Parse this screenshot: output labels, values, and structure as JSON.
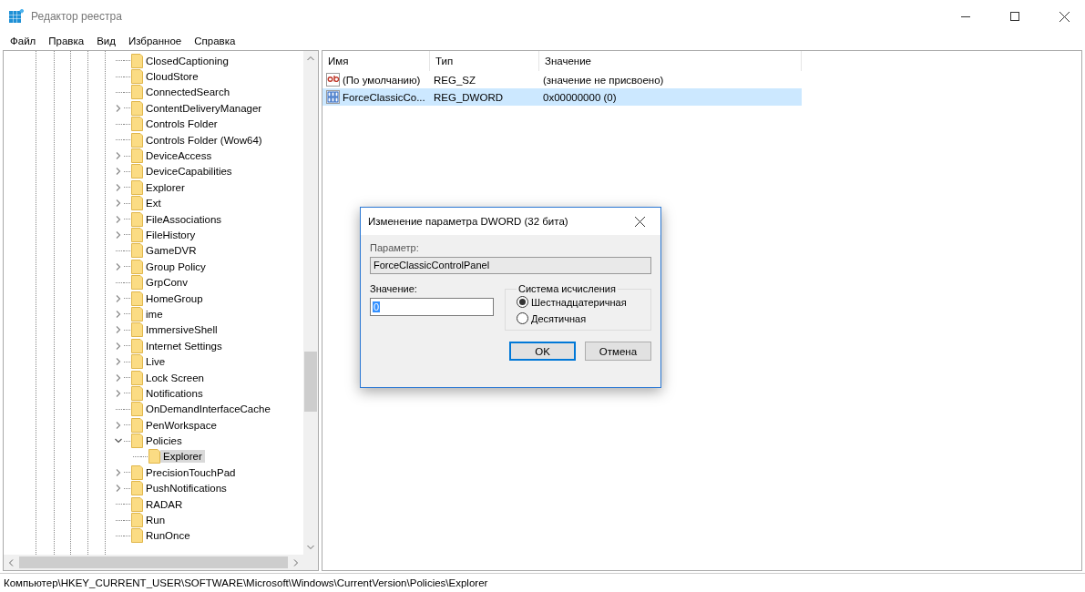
{
  "window": {
    "title": "Редактор реестра"
  },
  "menu": [
    "Файл",
    "Правка",
    "Вид",
    "Избранное",
    "Справка"
  ],
  "tree": [
    {
      "label": "ClosedCaptioning",
      "kind": "leaf",
      "selected": false
    },
    {
      "label": "CloudStore",
      "kind": "leaf",
      "selected": false
    },
    {
      "label": "ConnectedSearch",
      "kind": "leaf",
      "selected": false
    },
    {
      "label": "ContentDeliveryManager",
      "kind": "collapsed",
      "selected": false
    },
    {
      "label": "Controls Folder",
      "kind": "leaf",
      "selected": false
    },
    {
      "label": "Controls Folder (Wow64)",
      "kind": "leaf",
      "selected": false
    },
    {
      "label": "DeviceAccess",
      "kind": "collapsed",
      "selected": false
    },
    {
      "label": "DeviceCapabilities",
      "kind": "collapsed",
      "selected": false
    },
    {
      "label": "Explorer",
      "kind": "collapsed",
      "selected": false
    },
    {
      "label": "Ext",
      "kind": "collapsed",
      "selected": false
    },
    {
      "label": "FileAssociations",
      "kind": "collapsed",
      "selected": false
    },
    {
      "label": "FileHistory",
      "kind": "collapsed",
      "selected": false
    },
    {
      "label": "GameDVR",
      "kind": "leaf",
      "selected": false
    },
    {
      "label": "Group Policy",
      "kind": "collapsed",
      "selected": false
    },
    {
      "label": "GrpConv",
      "kind": "leaf",
      "selected": false
    },
    {
      "label": "HomeGroup",
      "kind": "collapsed",
      "selected": false
    },
    {
      "label": "ime",
      "kind": "collapsed",
      "selected": false
    },
    {
      "label": "ImmersiveShell",
      "kind": "collapsed",
      "selected": false
    },
    {
      "label": "Internet Settings",
      "kind": "collapsed",
      "selected": false
    },
    {
      "label": "Live",
      "kind": "collapsed",
      "selected": false
    },
    {
      "label": "Lock Screen",
      "kind": "collapsed",
      "selected": false
    },
    {
      "label": "Notifications",
      "kind": "collapsed",
      "selected": false
    },
    {
      "label": "OnDemandInterfaceCache",
      "kind": "leaf",
      "selected": false
    },
    {
      "label": "PenWorkspace",
      "kind": "collapsed",
      "selected": false
    },
    {
      "label": "Policies",
      "kind": "expanded",
      "selected": false,
      "children": [
        {
          "label": "Explorer",
          "kind": "leaf",
          "selected": true
        }
      ]
    },
    {
      "label": "PrecisionTouchPad",
      "kind": "collapsed",
      "selected": false
    },
    {
      "label": "PushNotifications",
      "kind": "collapsed",
      "selected": false
    },
    {
      "label": "RADAR",
      "kind": "leaf",
      "selected": false
    },
    {
      "label": "Run",
      "kind": "leaf",
      "selected": false
    },
    {
      "label": "RunOnce",
      "kind": "leaf",
      "selected": false
    }
  ],
  "values": {
    "columns": [
      "Имя",
      "Тип",
      "Значение"
    ],
    "rows": [
      {
        "kind": "string",
        "name": "(По умолчанию)",
        "type": "REG_SZ",
        "data": "(значение не присвоено)",
        "selected": false
      },
      {
        "kind": "binary",
        "name": "ForceClassicCo...",
        "type": "REG_DWORD",
        "data": "0x00000000 (0)",
        "selected": true
      }
    ]
  },
  "dialog": {
    "title": "Изменение параметра DWORD (32 бита)",
    "parameter_label": "Параметр:",
    "parameter_value": "ForceClassicControlPanel",
    "value_label": "Значение:",
    "value": "0",
    "base_group": {
      "title": "Система исчисления",
      "options": [
        {
          "label": "Шестнадцатеричная",
          "selected": true
        },
        {
          "label": "Десятичная",
          "selected": false
        }
      ]
    },
    "buttons": [
      {
        "label": "OK",
        "default": true
      },
      {
        "label": "Отмена",
        "default": false
      }
    ]
  },
  "status_bar": "Компьютер\\HKEY_CURRENT_USER\\SOFTWARE\\Microsoft\\Windows\\CurrentVersion\\Policies\\Explorer"
}
